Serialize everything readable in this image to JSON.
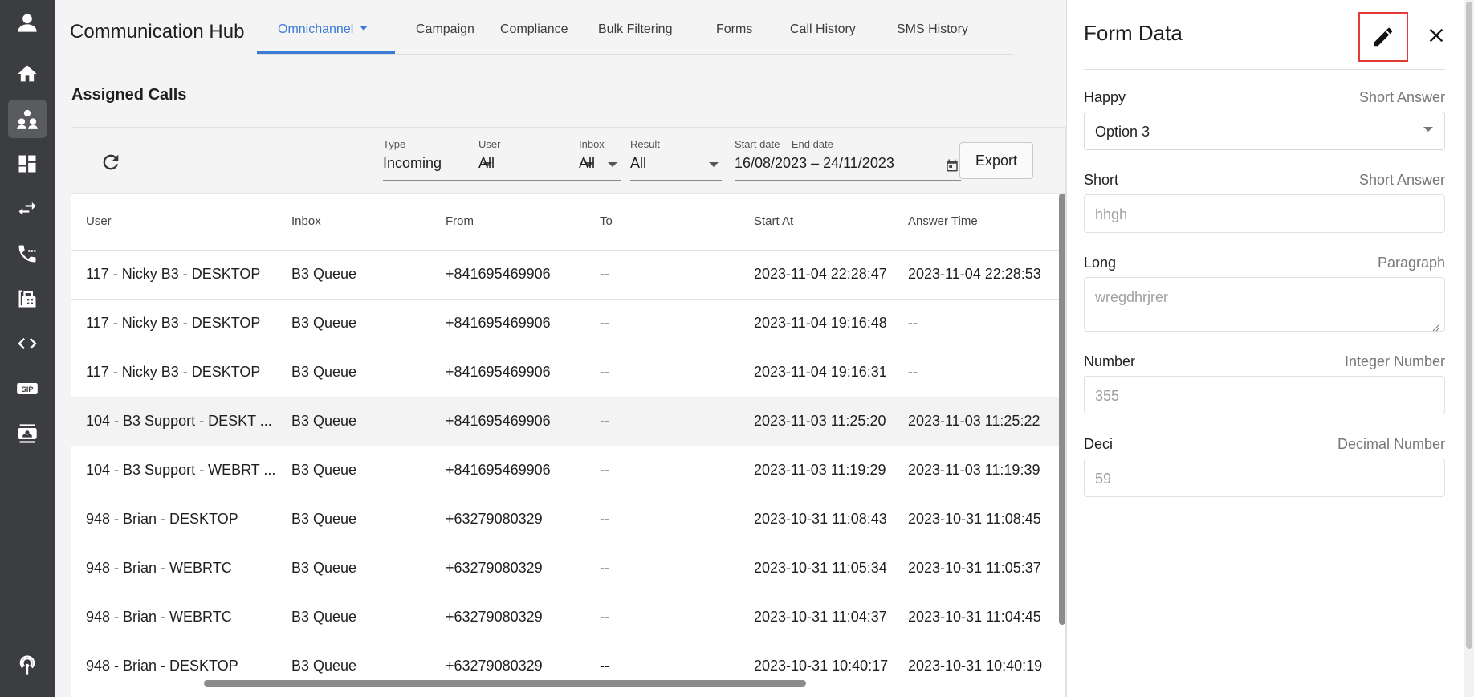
{
  "app": {
    "title": "Communication Hub"
  },
  "tabs": [
    {
      "label": "Omnichannel"
    },
    {
      "label": "Campaign"
    },
    {
      "label": "Compliance"
    },
    {
      "label": "Bulk Filtering"
    },
    {
      "label": "Forms"
    },
    {
      "label": "Call History"
    },
    {
      "label": "SMS History"
    }
  ],
  "sidebar": {
    "items": [
      "avatar-icon",
      "home-icon",
      "group-icon",
      "dashboard-icon",
      "swap-icon",
      "phone-icon",
      "fax-icon",
      "code-icon",
      "sip-icon",
      "contact-card-icon",
      "broadcast-icon"
    ],
    "sip_text": "SIP"
  },
  "section": {
    "title": "Assigned Calls"
  },
  "filters": {
    "type": {
      "label": "Type",
      "value": "Incoming"
    },
    "user": {
      "label": "User",
      "value": "All"
    },
    "inbox": {
      "label": "Inbox",
      "value": "All"
    },
    "result": {
      "label": "Result",
      "value": "All"
    },
    "date": {
      "label": "Start date – End date",
      "value": "16/08/2023 – 24/11/2023"
    },
    "export_label": "Export"
  },
  "table": {
    "columns": [
      "User",
      "Inbox",
      "From",
      "To",
      "Start At",
      "Answer Time"
    ],
    "rows": [
      [
        "117 - Nicky B3 - DESKTOP",
        "B3 Queue",
        "+841695469906",
        "--",
        "2023-11-04 22:28:47",
        "2023-11-04 22:28:53"
      ],
      [
        "117 - Nicky B3 - DESKTOP",
        "B3 Queue",
        "+841695469906",
        "--",
        "2023-11-04 19:16:48",
        "--"
      ],
      [
        "117 - Nicky B3 - DESKTOP",
        "B3 Queue",
        "+841695469906",
        "--",
        "2023-11-04 19:16:31",
        "--"
      ],
      [
        "104 - B3 Support - DESKT ...",
        "B3 Queue",
        "+841695469906",
        "--",
        "2023-11-03 11:25:20",
        "2023-11-03 11:25:22"
      ],
      [
        "104 - B3 Support - WEBRT ...",
        "B3 Queue",
        "+841695469906",
        "--",
        "2023-11-03 11:19:29",
        "2023-11-03 11:19:39"
      ],
      [
        "948 - Brian - DESKTOP",
        "B3 Queue",
        "+63279080329",
        "--",
        "2023-10-31 11:08:43",
        "2023-10-31 11:08:45"
      ],
      [
        "948 - Brian - WEBRTC",
        "B3 Queue",
        "+63279080329",
        "--",
        "2023-10-31 11:05:34",
        "2023-10-31 11:05:37"
      ],
      [
        "948 - Brian - WEBRTC",
        "B3 Queue",
        "+63279080329",
        "--",
        "2023-10-31 11:04:37",
        "2023-10-31 11:04:45"
      ],
      [
        "948 - Brian - DESKTOP",
        "B3 Queue",
        "+63279080329",
        "--",
        "2023-10-31 10:40:17",
        "2023-10-31 10:40:19"
      ]
    ]
  },
  "panel": {
    "title": "Form Data",
    "fields": [
      {
        "label": "Happy",
        "type": "Short Answer",
        "value": "Option 3"
      },
      {
        "label": "Short",
        "type": "Short Answer",
        "value": "hhgh"
      },
      {
        "label": "Long",
        "type": "Paragraph",
        "value": "wregdhrjrer"
      },
      {
        "label": "Number",
        "type": "Integer Number",
        "value": "355"
      },
      {
        "label": "Deci",
        "type": "Decimal Number",
        "value": "59"
      }
    ]
  },
  "colors": {
    "accent": "#3a7bd5",
    "sidebar": "#3b3d40",
    "highlight": "#e13b3b"
  }
}
